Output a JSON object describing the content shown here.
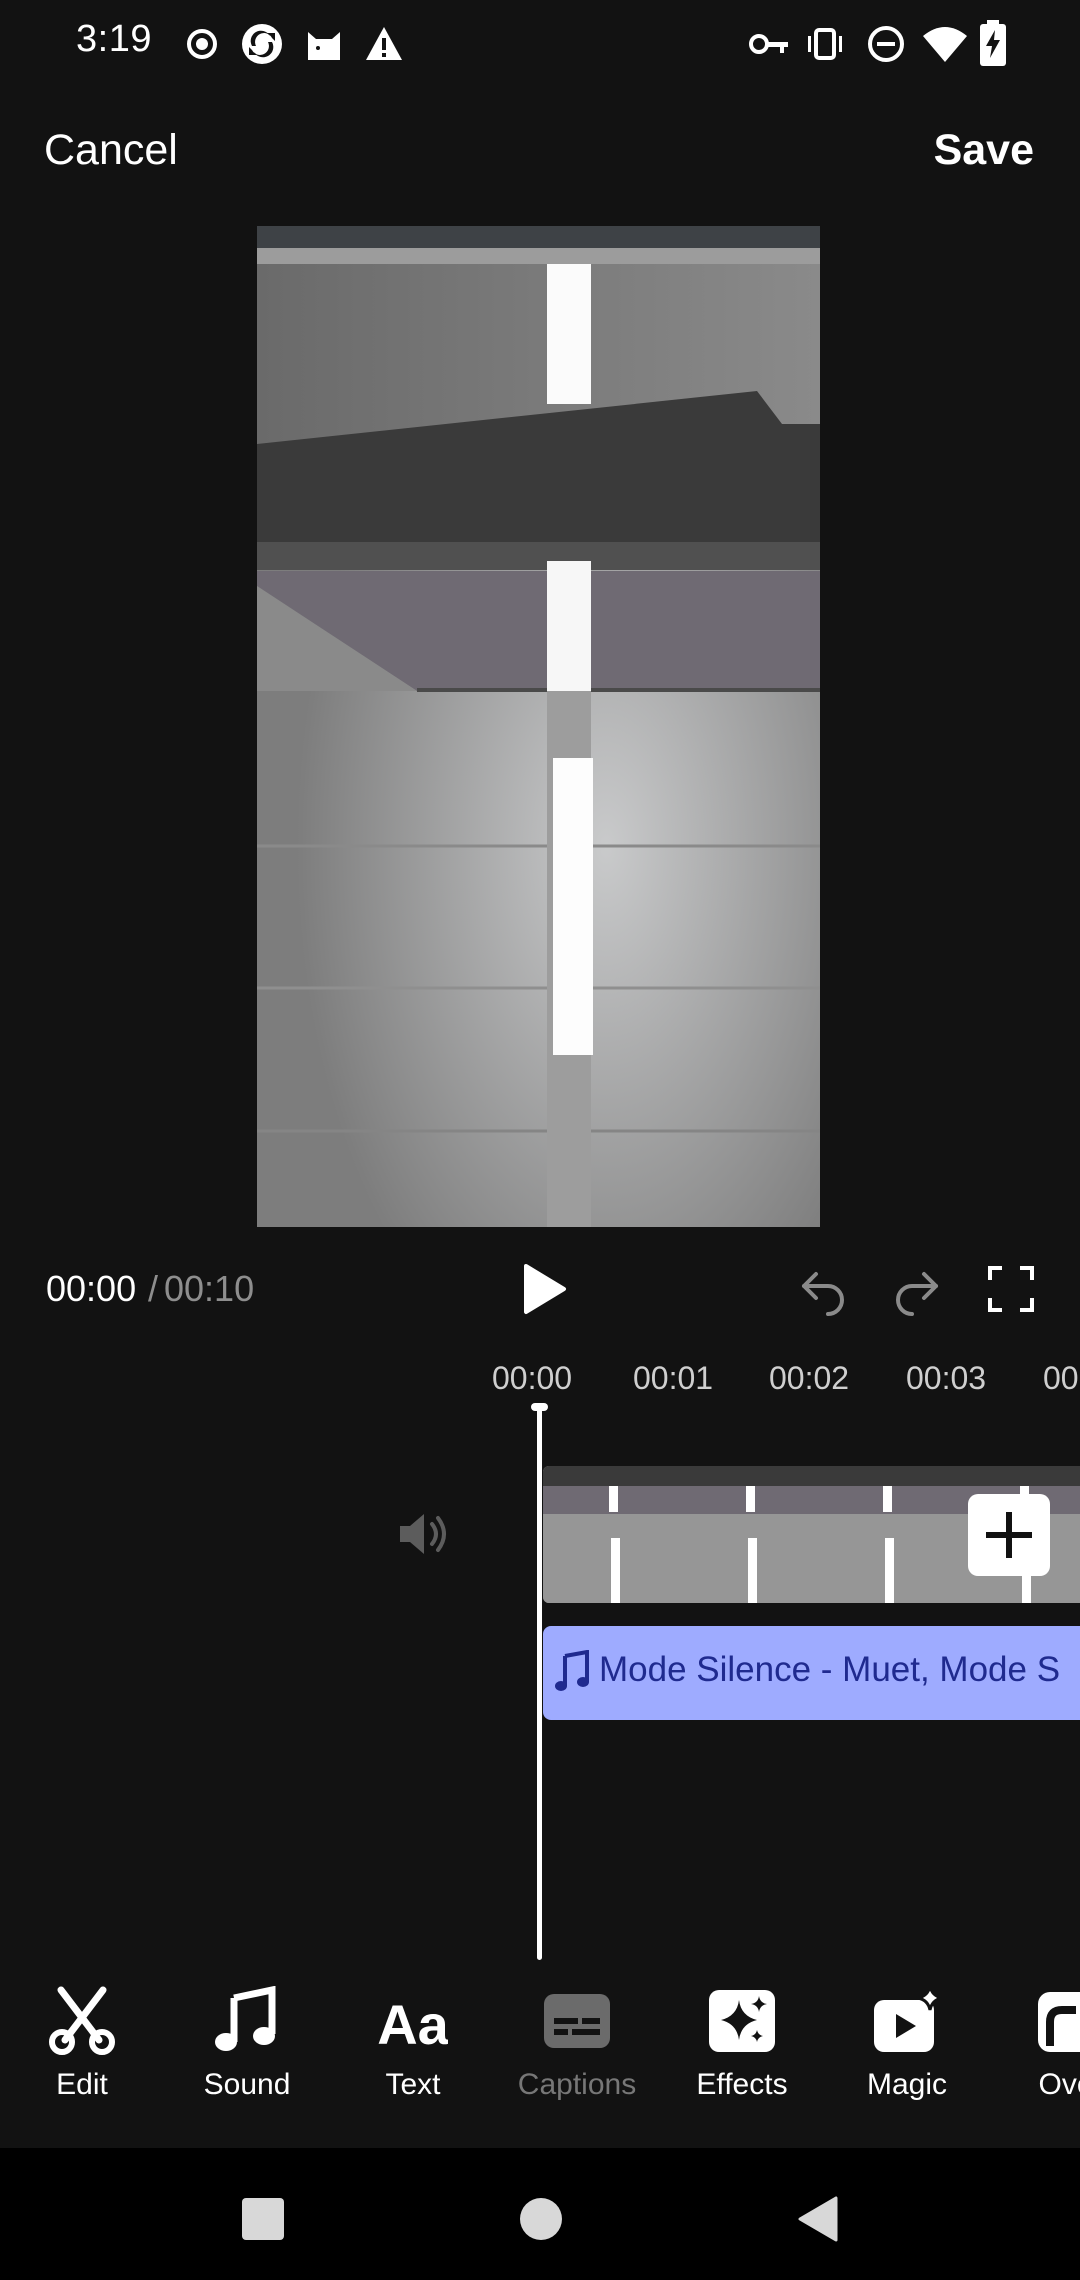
{
  "status_bar": {
    "time": "3:19",
    "left_icons": [
      "record-icon",
      "sync-icon",
      "cat-icon",
      "warning-icon"
    ],
    "right_icons": [
      "key-icon",
      "vibrate-icon",
      "dnd-icon",
      "wifi-icon",
      "battery-charging-icon"
    ]
  },
  "header": {
    "cancel_label": "Cancel",
    "save_label": "Save"
  },
  "playback": {
    "current_time": "00:00",
    "separator": "/",
    "total_time": "00:10"
  },
  "ruler": {
    "ticks": [
      "00:00",
      "00:01",
      "00:02",
      "00:03",
      "00"
    ]
  },
  "timeline": {
    "audio_track_label": "Mode Silence - Muet, Mode S"
  },
  "toolbar": {
    "items": [
      {
        "label": "Edit",
        "icon": "scissors-icon",
        "enabled": true
      },
      {
        "label": "Sound",
        "icon": "music-note-icon",
        "enabled": true
      },
      {
        "label": "Text",
        "icon": "text-aa-icon",
        "enabled": true
      },
      {
        "label": "Captions",
        "icon": "captions-icon",
        "enabled": false
      },
      {
        "label": "Effects",
        "icon": "sparkles-icon",
        "enabled": true
      },
      {
        "label": "Magic",
        "icon": "magic-play-icon",
        "enabled": true
      },
      {
        "label": "Over",
        "icon": "overlay-icon",
        "enabled": true
      }
    ]
  },
  "colors": {
    "background": "#121212",
    "audio_track": "#9eabff",
    "audio_text": "#1f2a8f",
    "muted_text": "#8e8e8e"
  }
}
